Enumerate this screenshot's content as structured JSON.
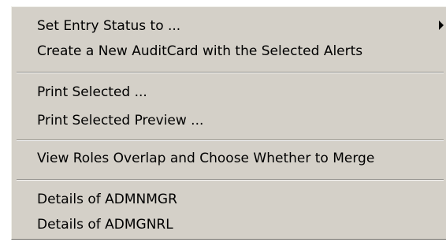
{
  "menu": {
    "items": [
      {
        "label": "Set Entry Status to ...",
        "has_submenu": true
      },
      {
        "label": "Create a New AuditCard with the Selected Alerts"
      },
      {
        "label": "Print Selected ..."
      },
      {
        "label": "Print Selected Preview ..."
      },
      {
        "label": "View Roles Overlap and Choose Whether to Merge"
      },
      {
        "label": "Details of ADMNMGR"
      },
      {
        "label": "Details of ADMGNRL"
      }
    ]
  }
}
